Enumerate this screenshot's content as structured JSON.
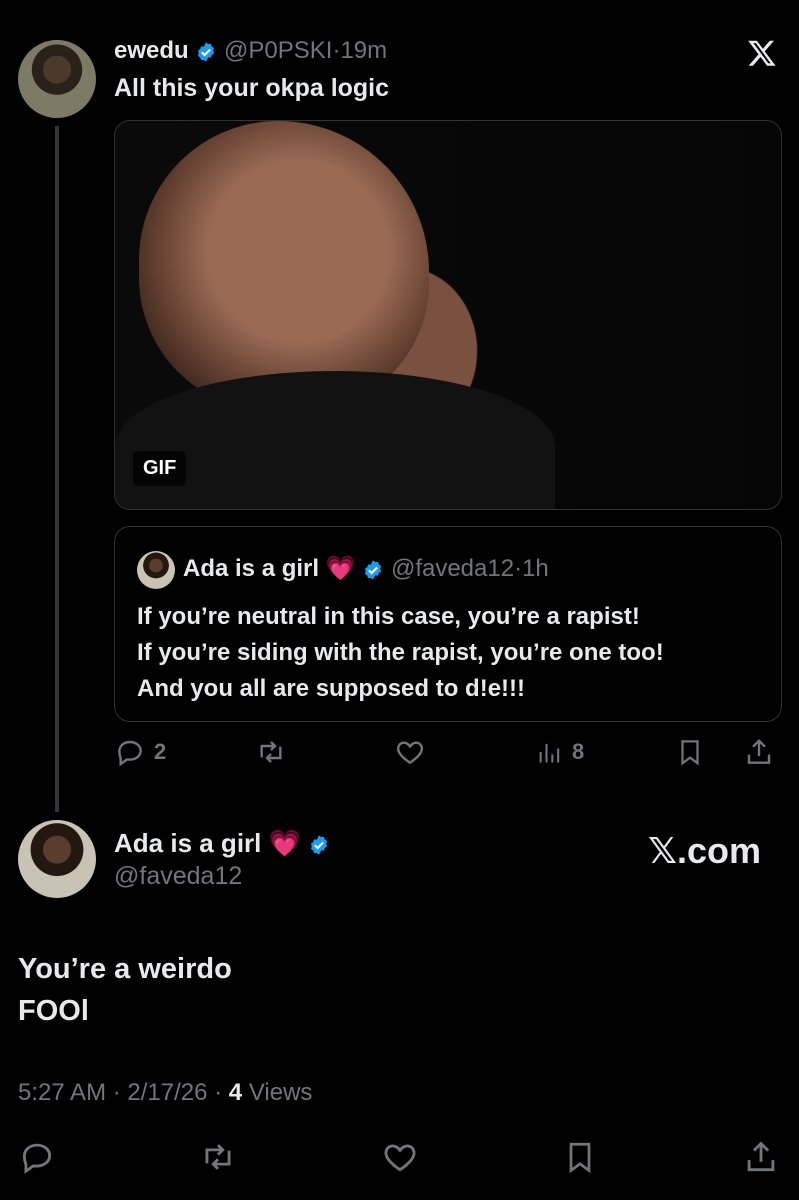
{
  "reply_tweet": {
    "author_name": "ewedu",
    "handle": "@P0PSKI",
    "separator": "·",
    "time": "19m",
    "text": "All this your okpa logic",
    "gif_badge": "GIF",
    "quote": {
      "author_name": "Ada is a girl",
      "emoji": "💗",
      "handle": "@faveda12",
      "separator": "·",
      "time": "1h",
      "line1": "If you’re neutral in this case, you’re a rapist!",
      "line2": "If you’re siding with the rapist, you’re one too!",
      "line3": "And you all are supposed to d!e!!!"
    },
    "actions": {
      "replies": "2",
      "views": "8"
    }
  },
  "main_tweet": {
    "author_name": "Ada is a girl",
    "emoji": "💗",
    "handle": "@faveda12",
    "watermark": "𝕏.com",
    "text_line1": "You’re a weirdo",
    "text_line2": "FOOl",
    "timestamp": "5:27 AM · 2/17/26 · ",
    "views_count": "4",
    "views_label": "Views"
  },
  "close_icon": "x-logo-icon",
  "colors": {
    "background": "#000000",
    "verified": "#1d9bf0",
    "muted": "#71767b",
    "text": "#e7e9ea"
  }
}
